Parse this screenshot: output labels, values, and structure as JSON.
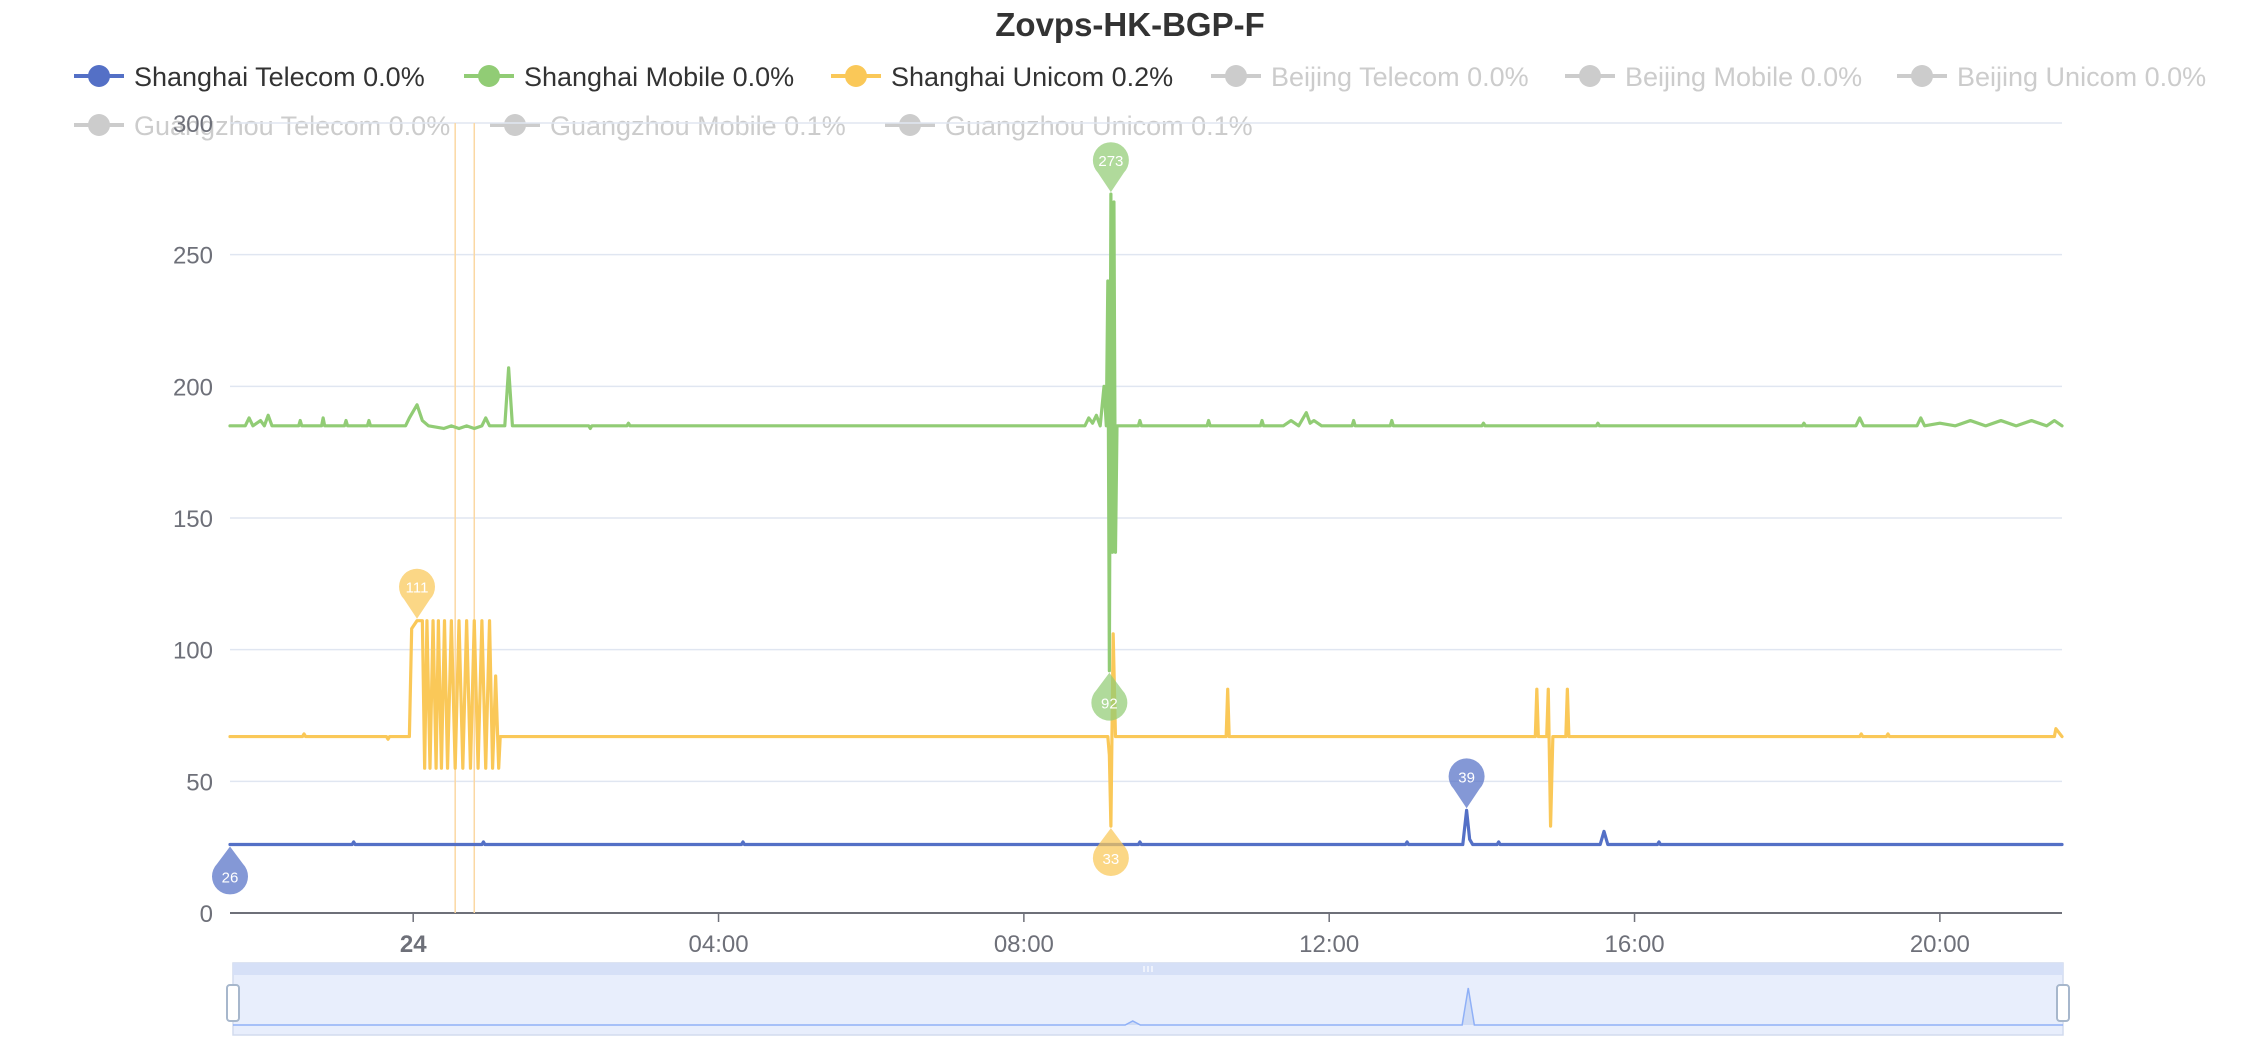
{
  "chart_data": {
    "type": "line",
    "title": "Zovps-HK-BGP-F",
    "xlabel": "",
    "ylabel": "",
    "ylim": [
      0,
      300
    ],
    "x_range_hours": [
      -2.4,
      21.6
    ],
    "y_ticks": [
      0,
      50,
      100,
      150,
      200,
      250,
      300
    ],
    "x_ticks": [
      {
        "label": "24",
        "hour": 0,
        "bold": true
      },
      {
        "label": "04:00",
        "hour": 4,
        "bold": false
      },
      {
        "label": "08:00",
        "hour": 8,
        "bold": false
      },
      {
        "label": "12:00",
        "hour": 12,
        "bold": false
      },
      {
        "label": "16:00",
        "hour": 16,
        "bold": false
      },
      {
        "label": "20:00",
        "hour": 20,
        "bold": false
      }
    ],
    "grid": true,
    "legend_position": "top",
    "legend": [
      {
        "label": "Shanghai Telecom 0.0%",
        "color": "#5470c6",
        "active": true
      },
      {
        "label": "Shanghai Mobile 0.0%",
        "color": "#91cc75",
        "active": true
      },
      {
        "label": "Shanghai Unicom 0.2%",
        "color": "#fac858",
        "active": true
      },
      {
        "label": "Beijing Telecom 0.0%",
        "color": "#cccccc",
        "active": false
      },
      {
        "label": "Beijing Mobile 0.0%",
        "color": "#cccccc",
        "active": false
      },
      {
        "label": "Beijing Unicom 0.0%",
        "color": "#cccccc",
        "active": false
      },
      {
        "label": "Guangzhou Telecom 0.0%",
        "color": "#cccccc",
        "active": false
      },
      {
        "label": "Guangzhou Mobile 0.1%",
        "color": "#cccccc",
        "active": false
      },
      {
        "label": "Guangzhou Unicom 0.1%",
        "color": "#cccccc",
        "active": false
      }
    ],
    "mark_lines_hours": [
      0.55,
      0.8
    ],
    "series": [
      {
        "name": "Shanghai Telecom",
        "color": "#5470c6",
        "base": 26,
        "points": [
          [
            -2.4,
            26
          ],
          [
            -0.8,
            26
          ],
          [
            -0.78,
            27
          ],
          [
            -0.76,
            26
          ],
          [
            0.9,
            26
          ],
          [
            0.92,
            27
          ],
          [
            0.94,
            26
          ],
          [
            4.3,
            26
          ],
          [
            4.32,
            27
          ],
          [
            4.34,
            26
          ],
          [
            9.5,
            26
          ],
          [
            9.52,
            27
          ],
          [
            9.54,
            26
          ],
          [
            13.0,
            26
          ],
          [
            13.02,
            27
          ],
          [
            13.04,
            26
          ],
          [
            13.75,
            26
          ],
          [
            13.8,
            39
          ],
          [
            13.84,
            28
          ],
          [
            13.88,
            26
          ],
          [
            14.2,
            26
          ],
          [
            14.22,
            27
          ],
          [
            14.24,
            26
          ],
          [
            15.55,
            26
          ],
          [
            15.6,
            31
          ],
          [
            15.65,
            26
          ],
          [
            16.3,
            26
          ],
          [
            16.32,
            27
          ],
          [
            16.34,
            26
          ],
          [
            21.6,
            26
          ]
        ],
        "pins": [
          {
            "label": "26",
            "hour": -2.4,
            "value": 26,
            "kind": "min"
          },
          {
            "label": "39",
            "hour": 13.8,
            "value": 39,
            "kind": "max"
          }
        ]
      },
      {
        "name": "Shanghai Mobile",
        "color": "#91cc75",
        "base": 185,
        "points": [
          [
            -2.4,
            185
          ],
          [
            -2.2,
            185
          ],
          [
            -2.15,
            188
          ],
          [
            -2.1,
            185
          ],
          [
            -2.0,
            187
          ],
          [
            -1.95,
            185
          ],
          [
            -1.9,
            189
          ],
          [
            -1.85,
            185
          ],
          [
            -1.5,
            185
          ],
          [
            -1.48,
            187
          ],
          [
            -1.46,
            185
          ],
          [
            -1.2,
            185
          ],
          [
            -1.18,
            188
          ],
          [
            -1.16,
            185
          ],
          [
            -0.9,
            185
          ],
          [
            -0.88,
            187
          ],
          [
            -0.86,
            185
          ],
          [
            -0.6,
            185
          ],
          [
            -0.58,
            187
          ],
          [
            -0.56,
            185
          ],
          [
            -0.1,
            185
          ],
          [
            -0.05,
            188
          ],
          [
            0.05,
            193
          ],
          [
            0.12,
            187
          ],
          [
            0.2,
            185
          ],
          [
            0.4,
            184
          ],
          [
            0.5,
            185
          ],
          [
            0.6,
            184
          ],
          [
            0.7,
            185
          ],
          [
            0.8,
            184
          ],
          [
            0.9,
            185
          ],
          [
            0.95,
            188
          ],
          [
            1.0,
            185
          ],
          [
            1.2,
            185
          ],
          [
            1.25,
            207
          ],
          [
            1.3,
            185
          ],
          [
            2.3,
            185
          ],
          [
            2.32,
            184
          ],
          [
            2.34,
            185
          ],
          [
            2.8,
            185
          ],
          [
            2.82,
            186
          ],
          [
            2.84,
            185
          ],
          [
            8.8,
            185
          ],
          [
            8.85,
            188
          ],
          [
            8.9,
            186
          ],
          [
            8.95,
            189
          ],
          [
            9.0,
            185
          ],
          [
            9.05,
            200
          ],
          [
            9.08,
            185
          ],
          [
            9.1,
            240
          ],
          [
            9.12,
            92
          ],
          [
            9.14,
            273
          ],
          [
            9.16,
            137
          ],
          [
            9.18,
            270
          ],
          [
            9.2,
            137
          ],
          [
            9.22,
            185
          ],
          [
            9.3,
            185
          ],
          [
            9.5,
            185
          ],
          [
            9.52,
            187
          ],
          [
            9.54,
            185
          ],
          [
            10.4,
            185
          ],
          [
            10.42,
            187
          ],
          [
            10.44,
            185
          ],
          [
            11.1,
            185
          ],
          [
            11.12,
            187
          ],
          [
            11.14,
            185
          ],
          [
            11.4,
            185
          ],
          [
            11.5,
            187
          ],
          [
            11.6,
            185
          ],
          [
            11.7,
            190
          ],
          [
            11.75,
            186
          ],
          [
            11.8,
            187
          ],
          [
            11.9,
            185
          ],
          [
            12.3,
            185
          ],
          [
            12.32,
            187
          ],
          [
            12.34,
            185
          ],
          [
            12.8,
            185
          ],
          [
            12.82,
            187
          ],
          [
            12.84,
            185
          ],
          [
            14.0,
            185
          ],
          [
            14.02,
            186
          ],
          [
            14.04,
            185
          ],
          [
            15.5,
            185
          ],
          [
            15.52,
            186
          ],
          [
            15.54,
            185
          ],
          [
            18.2,
            185
          ],
          [
            18.22,
            186
          ],
          [
            18.24,
            185
          ],
          [
            18.9,
            185
          ],
          [
            18.95,
            188
          ],
          [
            19.0,
            185
          ],
          [
            19.7,
            185
          ],
          [
            19.75,
            188
          ],
          [
            19.8,
            185
          ],
          [
            20.0,
            186
          ],
          [
            20.2,
            185
          ],
          [
            20.4,
            187
          ],
          [
            20.6,
            185
          ],
          [
            20.8,
            187
          ],
          [
            21.0,
            185
          ],
          [
            21.2,
            187
          ],
          [
            21.4,
            185
          ],
          [
            21.5,
            187
          ],
          [
            21.6,
            185
          ]
        ],
        "pins": [
          {
            "label": "273",
            "hour": 9.14,
            "value": 273,
            "kind": "max"
          },
          {
            "label": "92",
            "hour": 9.12,
            "value": 92,
            "kind": "min"
          }
        ]
      },
      {
        "name": "Shanghai Unicom",
        "color": "#fac858",
        "base": 67,
        "points": [
          [
            -2.4,
            67
          ],
          [
            -1.45,
            67
          ],
          [
            -1.43,
            68
          ],
          [
            -1.41,
            67
          ],
          [
            -0.35,
            67
          ],
          [
            -0.33,
            66
          ],
          [
            -0.31,
            67
          ],
          [
            -0.05,
            67
          ],
          [
            -0.02,
            108
          ],
          [
            0.05,
            111
          ],
          [
            0.12,
            111
          ],
          [
            0.15,
            55
          ],
          [
            0.18,
            111
          ],
          [
            0.22,
            55
          ],
          [
            0.26,
            111
          ],
          [
            0.3,
            55
          ],
          [
            0.33,
            111
          ],
          [
            0.37,
            55
          ],
          [
            0.41,
            111
          ],
          [
            0.45,
            55
          ],
          [
            0.5,
            111
          ],
          [
            0.55,
            55
          ],
          [
            0.6,
            111
          ],
          [
            0.65,
            55
          ],
          [
            0.7,
            111
          ],
          [
            0.75,
            55
          ],
          [
            0.8,
            111
          ],
          [
            0.85,
            55
          ],
          [
            0.9,
            111
          ],
          [
            0.95,
            55
          ],
          [
            1.0,
            111
          ],
          [
            1.04,
            55
          ],
          [
            1.08,
            90
          ],
          [
            1.12,
            55
          ],
          [
            1.14,
            67
          ],
          [
            9.1,
            67
          ],
          [
            9.12,
            60
          ],
          [
            9.14,
            33
          ],
          [
            9.17,
            106
          ],
          [
            9.2,
            67
          ],
          [
            10.65,
            67
          ],
          [
            10.67,
            85
          ],
          [
            10.69,
            67
          ],
          [
            14.7,
            67
          ],
          [
            14.72,
            85
          ],
          [
            14.74,
            67
          ],
          [
            14.85,
            67
          ],
          [
            14.87,
            85
          ],
          [
            14.9,
            33
          ],
          [
            14.93,
            67
          ],
          [
            15.1,
            67
          ],
          [
            15.12,
            85
          ],
          [
            15.14,
            67
          ],
          [
            18.95,
            67
          ],
          [
            18.97,
            68
          ],
          [
            18.99,
            67
          ],
          [
            19.3,
            67
          ],
          [
            19.32,
            68
          ],
          [
            19.34,
            67
          ],
          [
            21.5,
            67
          ],
          [
            21.52,
            70
          ],
          [
            21.6,
            67
          ]
        ],
        "pins": [
          {
            "label": "111",
            "hour": 0.05,
            "value": 111,
            "kind": "max"
          },
          {
            "label": "33",
            "hour": 9.14,
            "value": 33,
            "kind": "min"
          }
        ]
      }
    ],
    "data_zoom": {
      "spike_hours": [
        9.4,
        13.8
      ]
    }
  }
}
